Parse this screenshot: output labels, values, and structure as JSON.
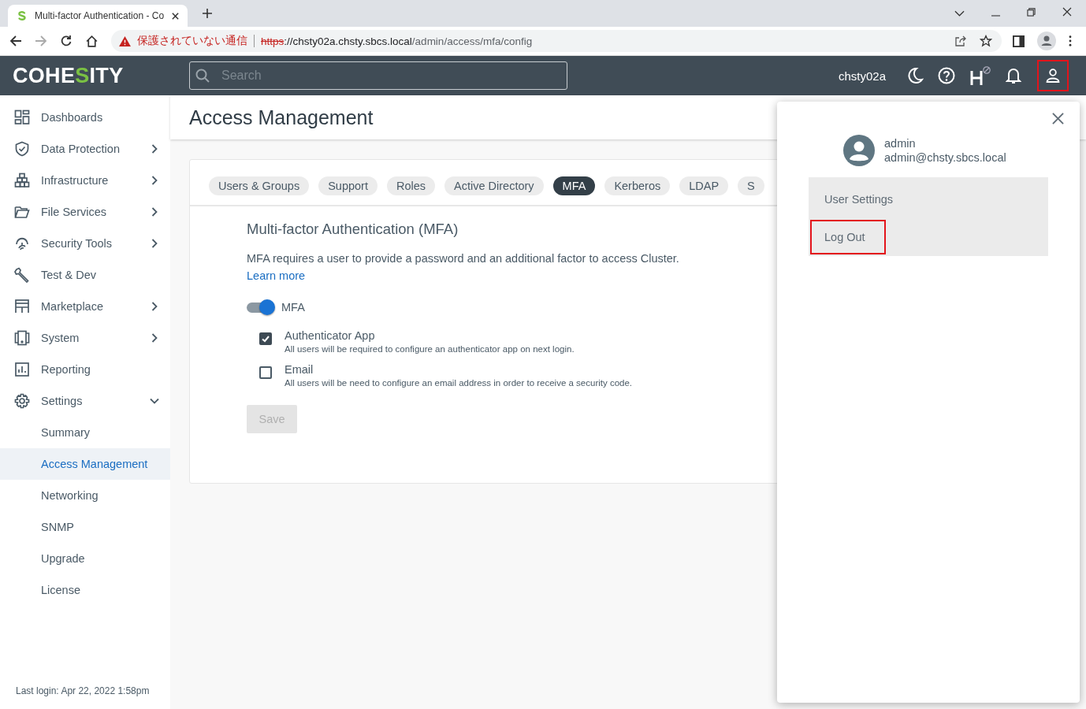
{
  "browser": {
    "tab_title": "Multi-factor Authentication - Co",
    "url_warning": "保護されていない通信",
    "url_scheme": "https",
    "url_host": "://chsty02a.chsty.sbcs.local",
    "url_path": "/admin/access/mfa/config"
  },
  "header": {
    "logo": {
      "before": "COHE",
      "accent": "S",
      "after": "ITY"
    },
    "search": {
      "placeholder": "Search"
    },
    "cluster": "chsty02a",
    "user_button_highlighted": true
  },
  "sidebar": {
    "items": [
      {
        "label": "Dashboards",
        "kind": "link"
      },
      {
        "label": "Data Protection",
        "kind": "group",
        "expanded": false
      },
      {
        "label": "Infrastructure",
        "kind": "group",
        "expanded": false
      },
      {
        "label": "File Services",
        "kind": "group",
        "expanded": false
      },
      {
        "label": "Security Tools",
        "kind": "group",
        "expanded": false
      },
      {
        "label": "Test & Dev",
        "kind": "link"
      },
      {
        "label": "Marketplace",
        "kind": "group",
        "expanded": false
      },
      {
        "label": "System",
        "kind": "group",
        "expanded": false
      },
      {
        "label": "Reporting",
        "kind": "link"
      },
      {
        "label": "Settings",
        "kind": "group",
        "expanded": true,
        "children": [
          {
            "label": "Summary",
            "selected": false
          },
          {
            "label": "Access Management",
            "selected": true
          },
          {
            "label": "Networking",
            "selected": false
          },
          {
            "label": "SNMP",
            "selected": false
          },
          {
            "label": "Upgrade",
            "selected": false
          },
          {
            "label": "License",
            "selected": false
          }
        ]
      }
    ],
    "last_login": "Last login: Apr 22, 2022 1:58pm"
  },
  "page": {
    "title": "Access Management",
    "tabs": [
      {
        "label": "Users & Groups",
        "selected": false
      },
      {
        "label": "Support",
        "selected": false
      },
      {
        "label": "Roles",
        "selected": false
      },
      {
        "label": "Active Directory",
        "selected": false
      },
      {
        "label": "MFA",
        "selected": true
      },
      {
        "label": "Kerberos",
        "selected": false
      },
      {
        "label": "LDAP",
        "selected": false
      },
      {
        "label": "S",
        "selected": false
      }
    ],
    "section_title": "Multi-factor Authentication (MFA)",
    "description": "MFA requires a user to provide a password and an additional factor to access Cluster.",
    "learn_more": "Learn more",
    "mfa_toggle": {
      "label": "MFA",
      "on": true
    },
    "options": [
      {
        "label": "Authenticator App",
        "hint": "All users will be required to configure an authenticator app on next login.",
        "checked": true
      },
      {
        "label": "Email",
        "hint": "All users will be need to configure an email address in order to receive a security code.",
        "checked": false
      }
    ],
    "save": {
      "label": "Save",
      "disabled": true
    }
  },
  "user_menu": {
    "name": "admin",
    "email": "admin@chsty.sbcs.local",
    "items": [
      {
        "label": "User Settings",
        "highlighted": false
      },
      {
        "label": "Log Out",
        "highlighted": true
      }
    ]
  }
}
